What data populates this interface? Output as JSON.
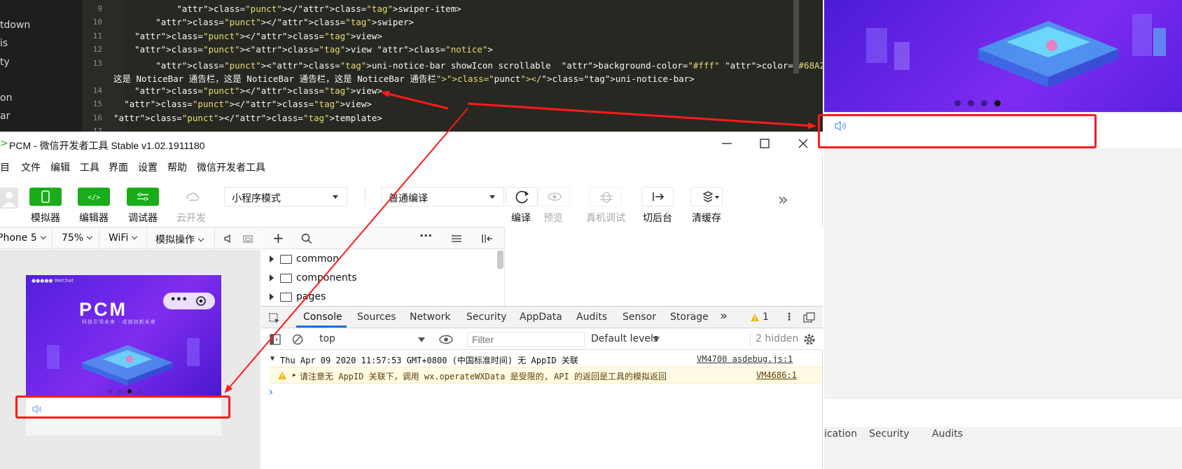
{
  "editor": {
    "sidebar_items": [
      "tdown",
      "is",
      "ty",
      "on",
      "ar"
    ],
    "line_numbers": [
      "9",
      "10",
      "11",
      "12",
      "13",
      "14",
      "15",
      "16",
      "17"
    ],
    "lines": [
      {
        "indent": "            ",
        "text": "</swiper-item>"
      },
      {
        "indent": "        ",
        "text": "</swiper>"
      },
      {
        "indent": "    ",
        "text": "</view>"
      },
      {
        "indent": "    ",
        "text": "<view class=\"notice\">"
      },
      {
        "indent": "        ",
        "text": "<uni-notice-bar showIcon scrollable  background-color=\"#fff\" color=\"#68A2FD\" single=\"true\" text=\"[单行]"
      },
      {
        "indent": "",
        "text": "这是 NoticeBar 通告栏，这是 NoticeBar 通告栏，这是 NoticeBar 通告栏\"></uni-notice-bar>"
      },
      {
        "indent": "    ",
        "text": "</view>"
      },
      {
        "indent": "  ",
        "text": "</view>"
      },
      {
        "indent": "",
        "text": "</template>"
      }
    ]
  },
  "window": {
    "title": "PCM - 微信开发者工具 Stable v1.02.1911180",
    "title_prefix": ">",
    "menu": [
      "项目",
      "文件",
      "编辑",
      "工具",
      "界面",
      "设置",
      "帮助",
      "微信开发者工具"
    ]
  },
  "toolbar": {
    "simulator_label": "模拟器",
    "editor_label": "编辑器",
    "debugger_label": "调试器",
    "cloud_label": "云开发",
    "mode_select": "小程序模式",
    "compile_select": "普通编译",
    "compile_label": "编译",
    "preview_label": "预览",
    "remote_debug_label": "真机调试",
    "background_label": "切后台",
    "clear_cache_label": "清缓存",
    "more_icon": "»"
  },
  "simbar": {
    "device": "Phone 5",
    "zoom": "75%",
    "network": "WiFi",
    "operation": "模拟操作"
  },
  "phone": {
    "logo": "PCM",
    "subtitle": "科技引领未来 · 成就创新未来",
    "status": "●●●●● WeChat",
    "swiper_dots": 4,
    "active_dot": 3
  },
  "preview_right": {
    "swiper_dots": 4,
    "active_dot": 4,
    "bottom_tabs": [
      "ication",
      "Security",
      "Audits"
    ]
  },
  "file_tree": {
    "items": [
      "common",
      "components",
      "pages"
    ]
  },
  "devtools": {
    "tabs": [
      "Console",
      "Sources",
      "Network",
      "Security",
      "AppData",
      "Audits",
      "Sensor",
      "Storage"
    ],
    "active_tab": "Console",
    "more_tabs": "»",
    "warning_count": "1",
    "context": "top",
    "filter_placeholder": "Filter",
    "levels": "Default levels",
    "hidden": "2 hidden",
    "log_group": "Thu Apr 09 2020 11:57:53 GMT+0800 (中国标准时间) 无 AppID 关联",
    "log_group_source": "VM4700 asdebug.js:1",
    "warning_text": "请注意无 AppID 关联下，调用 wx.operateWXData 是受限的, API 的返回是工具的模拟返回",
    "warning_source": "VM4686:1",
    "prompt": "›"
  },
  "colors": {
    "accent_green": "#1aad19",
    "notice_icon": "#68A2FD",
    "annotation_red": "#ff1a1a",
    "tab_active": "#1a73e8"
  }
}
